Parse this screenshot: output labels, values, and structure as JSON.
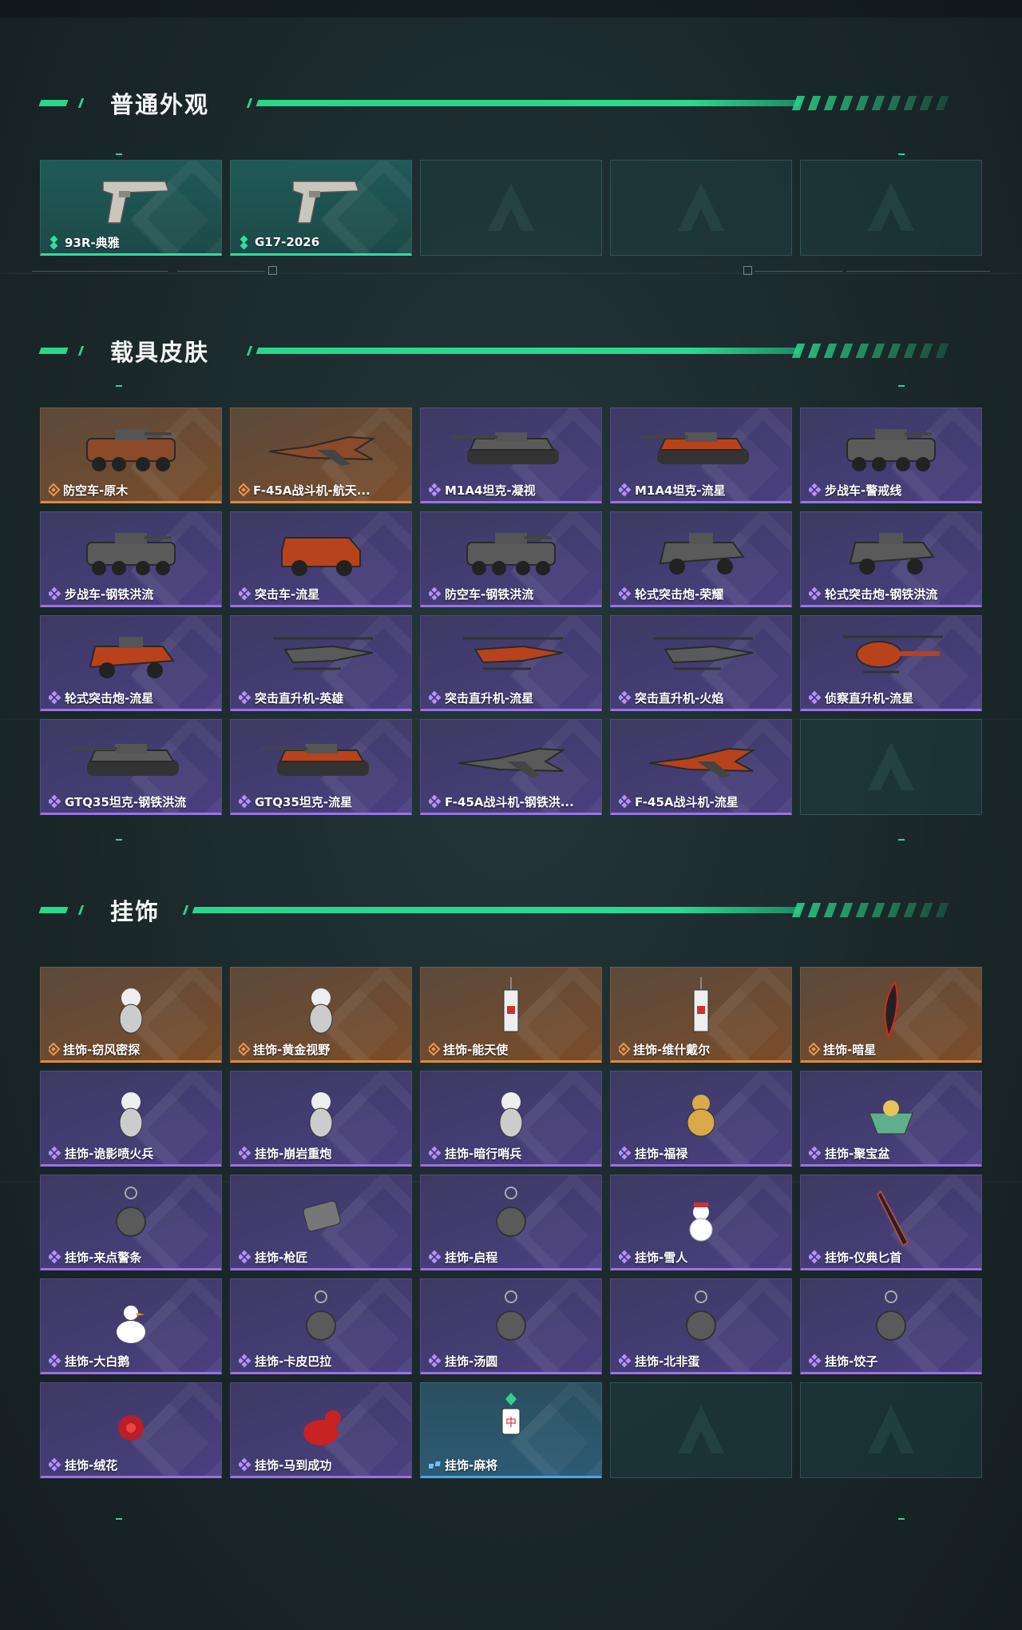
{
  "sections": [
    {
      "title": "普通外观",
      "items": [
        {
          "label": "93R-典雅",
          "rarity": "teal",
          "icon": "pistol-icon"
        },
        {
          "label": "G17-2026",
          "rarity": "teal",
          "icon": "pistol-icon"
        },
        {
          "label": "",
          "rarity": "empty"
        },
        {
          "label": "",
          "rarity": "empty"
        },
        {
          "label": "",
          "rarity": "empty"
        }
      ]
    },
    {
      "title": "载具皮肤",
      "items": [
        {
          "label": "防空车-原木",
          "rarity": "orange",
          "icon": "armored-car-icon"
        },
        {
          "label": "F-45A战斗机-航天...",
          "rarity": "orange",
          "icon": "fighter-jet-icon"
        },
        {
          "label": "M1A4坦克-凝视",
          "rarity": "purple",
          "icon": "tank-icon"
        },
        {
          "label": "M1A4坦克-流星",
          "rarity": "purple",
          "icon": "tank-icon"
        },
        {
          "label": "步战车-警戒线",
          "rarity": "purple",
          "icon": "armored-car-icon"
        },
        {
          "label": "步战车-钢铁洪流",
          "rarity": "purple",
          "icon": "armored-car-icon"
        },
        {
          "label": "突击车-流星",
          "rarity": "purple",
          "icon": "assault-vehicle-icon"
        },
        {
          "label": "防空车-钢铁洪流",
          "rarity": "purple",
          "icon": "armored-car-icon"
        },
        {
          "label": "轮式突击炮-荣耀",
          "rarity": "purple",
          "icon": "wheeled-gun-icon"
        },
        {
          "label": "轮式突击炮-钢铁洪流",
          "rarity": "purple",
          "icon": "wheeled-gun-icon"
        },
        {
          "label": "轮式突击炮-流星",
          "rarity": "purple",
          "icon": "wheeled-gun-icon"
        },
        {
          "label": "突击直升机-英雄",
          "rarity": "purple",
          "icon": "helicopter-icon"
        },
        {
          "label": "突击直升机-流星",
          "rarity": "purple",
          "icon": "helicopter-icon"
        },
        {
          "label": "突击直升机-火焰",
          "rarity": "purple",
          "icon": "helicopter-icon"
        },
        {
          "label": "侦察直升机-流星",
          "rarity": "purple",
          "icon": "scout-helicopter-icon"
        },
        {
          "label": "GTQ35坦克-钢铁洪流",
          "rarity": "purple",
          "icon": "tank-icon"
        },
        {
          "label": "GTQ35坦克-流星",
          "rarity": "purple",
          "icon": "tank-icon"
        },
        {
          "label": "F-45A战斗机-钢铁洪...",
          "rarity": "purple",
          "icon": "fighter-jet-icon"
        },
        {
          "label": "F-45A战斗机-流星",
          "rarity": "purple",
          "icon": "fighter-jet-icon"
        },
        {
          "label": "",
          "rarity": "empty"
        }
      ]
    },
    {
      "title": "挂饰",
      "items": [
        {
          "label": "挂饰-窃风密探",
          "rarity": "orange",
          "icon": "charm-figure-icon"
        },
        {
          "label": "挂饰-黄金视野",
          "rarity": "orange",
          "icon": "charm-figure-icon"
        },
        {
          "label": "挂饰-能天使",
          "rarity": "orange",
          "icon": "charm-tag-icon"
        },
        {
          "label": "挂饰-维什戴尔",
          "rarity": "orange",
          "icon": "charm-tag-icon"
        },
        {
          "label": "挂饰-暗星",
          "rarity": "orange",
          "icon": "charm-feather-icon"
        },
        {
          "label": "挂饰-诡影喷火兵",
          "rarity": "purple",
          "icon": "charm-figure-icon"
        },
        {
          "label": "挂饰-崩岩重炮",
          "rarity": "purple",
          "icon": "charm-figure-icon"
        },
        {
          "label": "挂饰-暗行哨兵",
          "rarity": "purple",
          "icon": "charm-figure-icon"
        },
        {
          "label": "挂饰-福禄",
          "rarity": "purple",
          "icon": "charm-gourd-icon"
        },
        {
          "label": "挂饰-聚宝盆",
          "rarity": "purple",
          "icon": "charm-bowl-icon"
        },
        {
          "label": "挂饰-来点警条",
          "rarity": "purple",
          "icon": "charm-ring-icon"
        },
        {
          "label": "挂饰-枪匠",
          "rarity": "purple",
          "icon": "charm-dogtag-icon"
        },
        {
          "label": "挂饰-启程",
          "rarity": "purple",
          "icon": "charm-ring-icon"
        },
        {
          "label": "挂饰-雪人",
          "rarity": "purple",
          "icon": "charm-snowman-icon"
        },
        {
          "label": "挂饰-仪典匕首",
          "rarity": "purple",
          "icon": "charm-dagger-icon"
        },
        {
          "label": "挂饰-大白鹅",
          "rarity": "purple",
          "icon": "charm-goose-icon"
        },
        {
          "label": "挂饰-卡皮巴拉",
          "rarity": "purple",
          "icon": "charm-ring-icon"
        },
        {
          "label": "挂饰-汤圆",
          "rarity": "purple",
          "icon": "charm-ring-icon"
        },
        {
          "label": "挂饰-北非蛋",
          "rarity": "purple",
          "icon": "charm-ring-icon"
        },
        {
          "label": "挂饰-饺子",
          "rarity": "purple",
          "icon": "charm-ring-icon"
        },
        {
          "label": "挂饰-绒花",
          "rarity": "purple",
          "icon": "charm-flower-icon"
        },
        {
          "label": "挂饰-马到成功",
          "rarity": "purple",
          "icon": "charm-horse-icon"
        },
        {
          "label": "挂饰-麻将",
          "rarity": "blue",
          "icon": "charm-mahjong-icon"
        },
        {
          "label": "",
          "rarity": "empty"
        },
        {
          "label": "",
          "rarity": "empty"
        }
      ]
    }
  ],
  "colors": {
    "accent": "#29d68c",
    "teal": "#2ee0a0",
    "orange": "#e08a3c",
    "purple": "#9b72e6",
    "blue": "#4aa8e8"
  }
}
